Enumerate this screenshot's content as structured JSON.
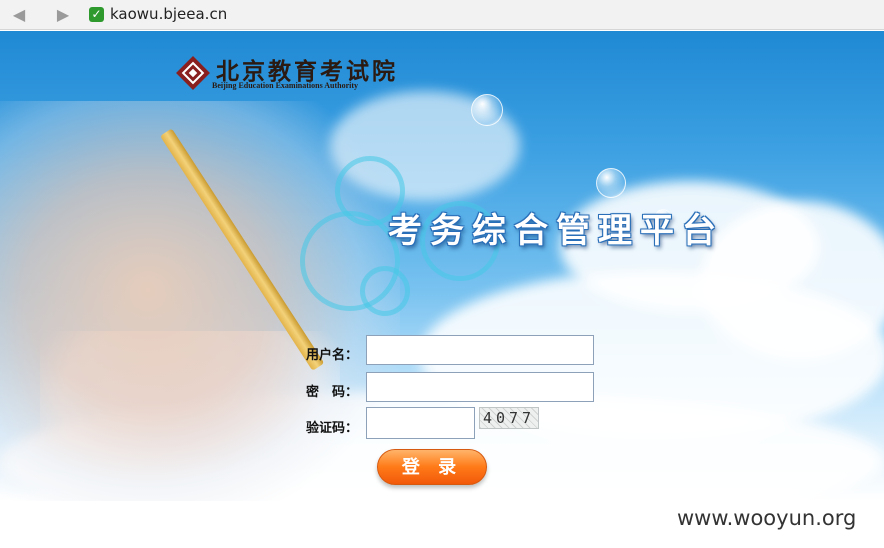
{
  "browser": {
    "back_icon": "back-arrow-icon",
    "forward_icon": "forward-arrow-icon",
    "secure_icon": "checkmark-icon",
    "url": "kaowu.bjeea.cn"
  },
  "logo": {
    "name_cn": "北京教育考试院",
    "name_en": "Beijing Education Examinations Authority"
  },
  "page": {
    "title": "考务综合管理平台"
  },
  "form": {
    "username_label": "用户名：",
    "password_label": "密　码：",
    "captcha_label": "验证码：",
    "username_value": "",
    "password_value": "",
    "captcha_value": "",
    "captcha_image_text": "4077",
    "login_button": "登 录"
  },
  "watermark": "www.wooyun.org",
  "colors": {
    "sky": "#3ca0e2",
    "login_orange": "#ff7a18",
    "title_outline": "#2a6fb8"
  }
}
